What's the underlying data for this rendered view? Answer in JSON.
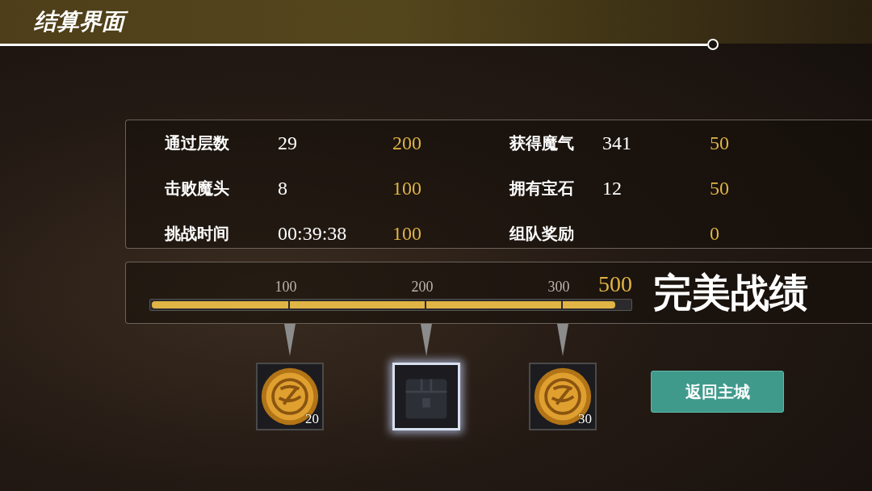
{
  "header": {
    "title": "结算界面"
  },
  "stats_left": [
    {
      "label": "通过层数",
      "value": "29",
      "points": "200"
    },
    {
      "label": "击败魔头",
      "value": "8",
      "points": "100"
    },
    {
      "label": "挑战时间",
      "value": "00:39:38",
      "points": "100"
    }
  ],
  "stats_right": [
    {
      "label": "获得魔气",
      "value": "341",
      "points": "50"
    },
    {
      "label": "拥有宝石",
      "value": "12",
      "points": "50"
    },
    {
      "label": "组队奖励",
      "points": "0"
    }
  ],
  "progress": {
    "ticks": [
      "100",
      "200",
      "300"
    ],
    "level": 0.97,
    "total": "500",
    "rating": "完美战绩"
  },
  "rewards": [
    {
      "kind": "coin",
      "count": "20",
      "selected": false
    },
    {
      "kind": "chest",
      "selected": true
    },
    {
      "kind": "coin",
      "count": "30",
      "selected": false
    }
  ],
  "button": {
    "label": "返回主城"
  }
}
